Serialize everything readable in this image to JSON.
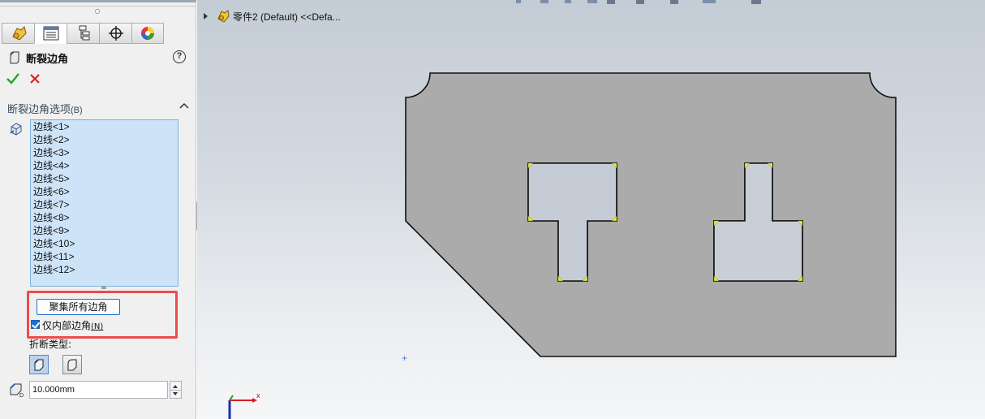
{
  "panel": {
    "tabs": [
      {
        "name": "featuremanager-tab",
        "icon": "featuremanager-icon"
      },
      {
        "name": "propertymanager-tab",
        "icon": "propertymanager-icon"
      },
      {
        "name": "configurationmanager-tab",
        "icon": "configurationmanager-icon"
      },
      {
        "name": "dimxpert-tab",
        "icon": "dimxpert-icon"
      },
      {
        "name": "displaymanager-tab",
        "icon": "displaymanager-icon"
      }
    ],
    "feature_title": "断裂边角",
    "help": "?",
    "section": {
      "title": "断裂边角选项",
      "shortcut": "(B)",
      "edges": [
        "边线<1>",
        "边线<2>",
        "边线<3>",
        "边线<4>",
        "边线<5>",
        "边线<6>",
        "边线<7>",
        "边线<8>",
        "边线<9>",
        "边线<10>",
        "边线<11>",
        "边线<12>"
      ],
      "collect_all_corners_label": "聚集所有边角",
      "internal_only_label": "仅内部边角",
      "internal_only_shortcut": "(N)",
      "internal_only_checked": true,
      "break_type_label": "折断类型:",
      "distance_value": "10.000mm"
    }
  },
  "viewport": {
    "tree_label": "零件2 (Default) <<Defa...",
    "axis_x": "x",
    "origin_glyph": "+"
  },
  "colors": {
    "highlight": "#ee4b4b",
    "list_bg": "#cde3f7",
    "corner_marker": "#e8ef3a",
    "part_fill": "#ababab"
  }
}
